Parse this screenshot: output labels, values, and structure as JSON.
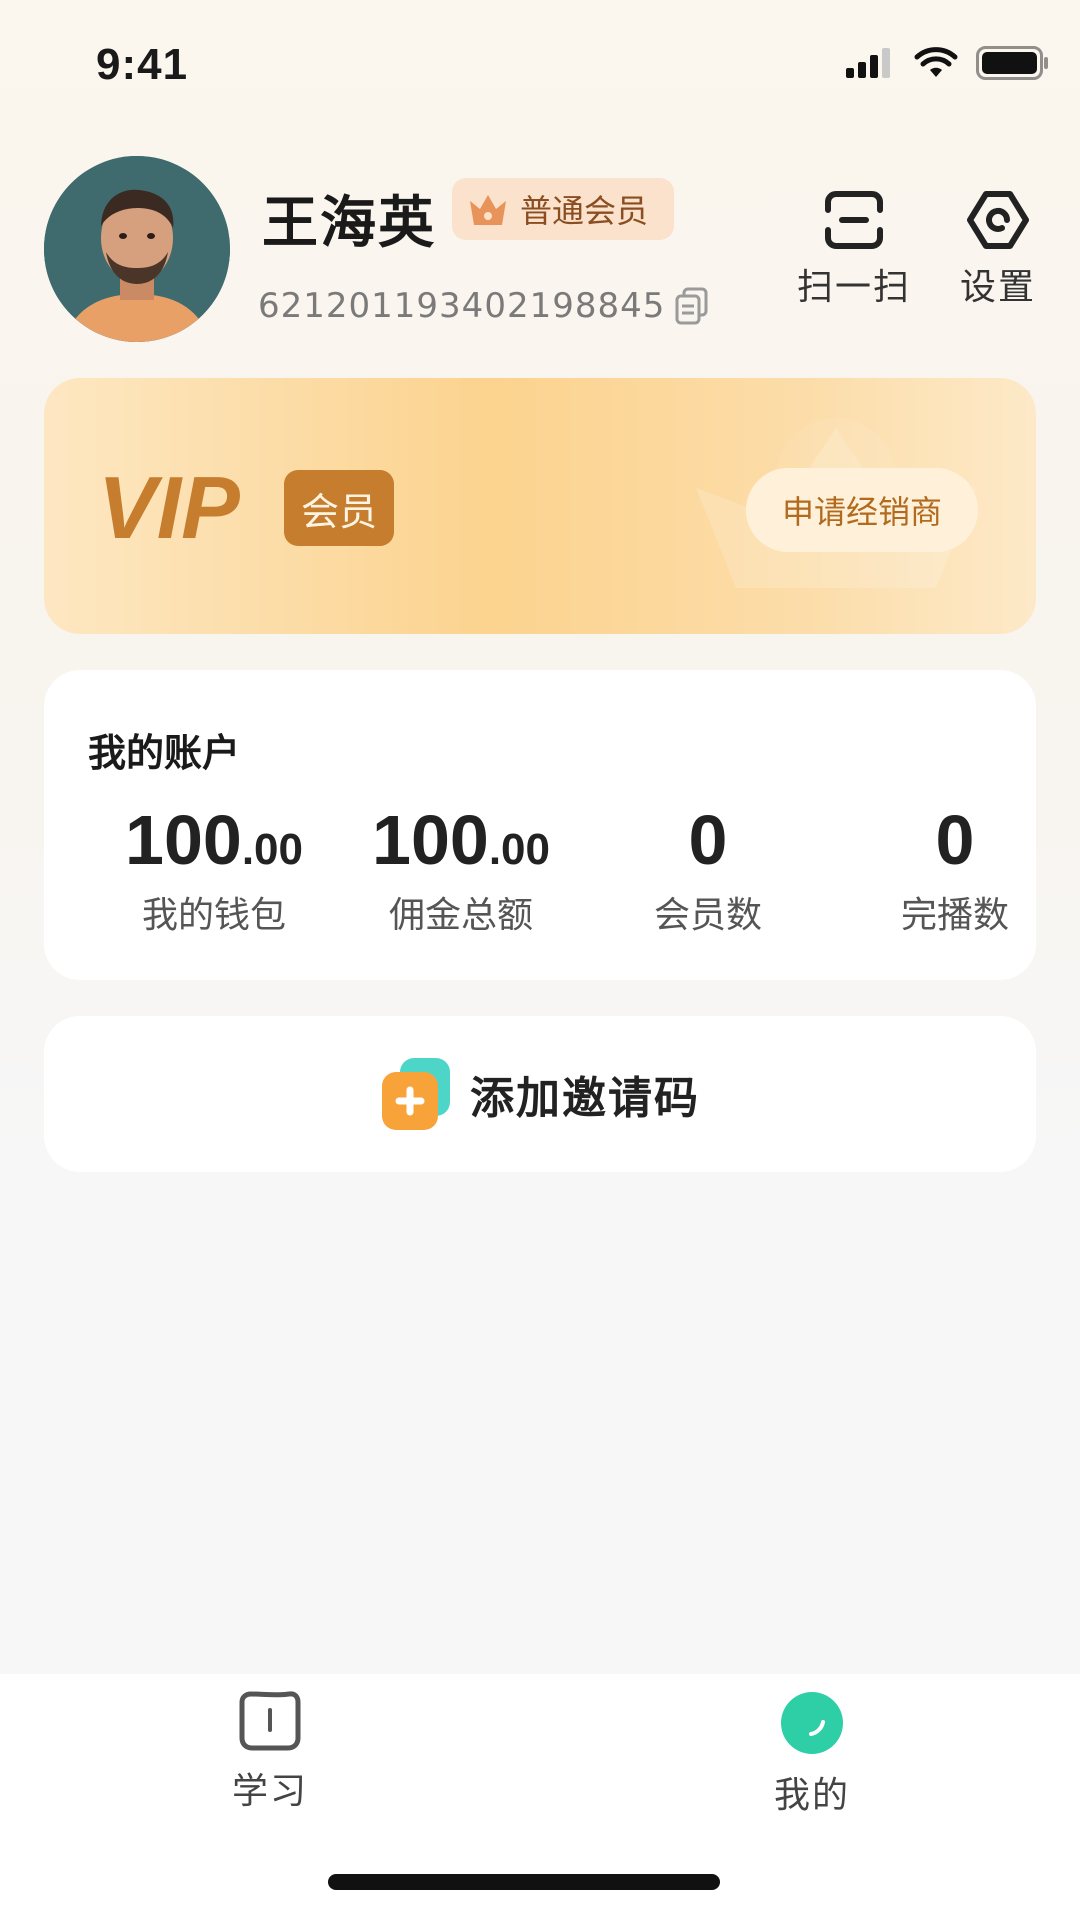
{
  "status_bar": {
    "time": "9:41"
  },
  "profile": {
    "name": "王海英",
    "member_level": "普通会员",
    "member_id": "621201193402198845"
  },
  "quick_actions": {
    "scan_label": "扫一扫",
    "settings_label": "设置"
  },
  "vip_card": {
    "logo_text": "VIP",
    "tag_text": "会员",
    "apply_button": "申请经销商"
  },
  "account": {
    "title": "我的账户",
    "stats": [
      {
        "integer": "100",
        "decimal": ".00",
        "label": "我的钱包"
      },
      {
        "integer": "100",
        "decimal": ".00",
        "label": "佣金总额"
      },
      {
        "integer": "0",
        "decimal": "",
        "label": "会员数"
      },
      {
        "integer": "0",
        "decimal": "",
        "label": "完播数"
      }
    ]
  },
  "invite": {
    "label": "添加邀请码"
  },
  "tab_bar": {
    "items": [
      {
        "label": "学习",
        "active": false
      },
      {
        "label": "我的",
        "active": true
      }
    ]
  },
  "colors": {
    "accent": "#2ecfa6",
    "vip_brown": "#c67d2d",
    "badge_bg": "#fbe2cc"
  }
}
